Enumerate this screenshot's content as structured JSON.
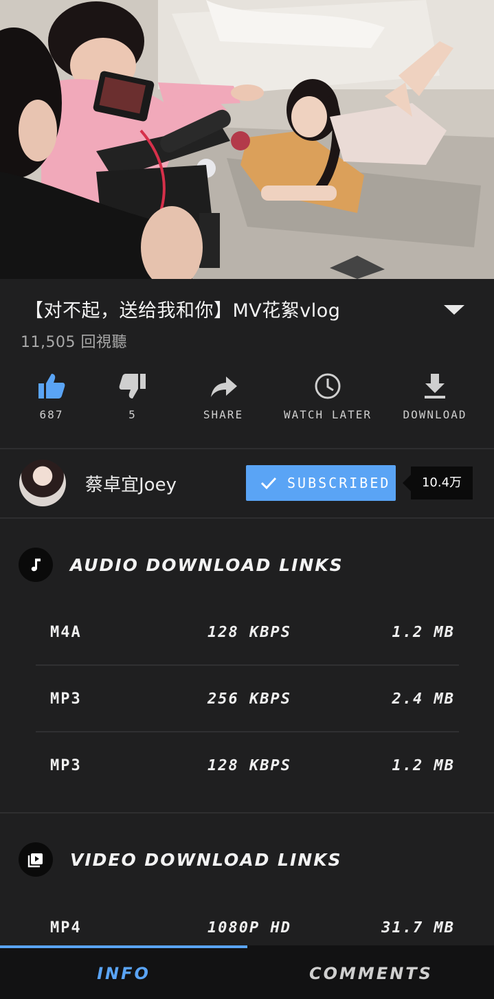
{
  "video": {
    "title": "【对不起，送给我和你】MV花絮vlog",
    "views": "11,505 回視聽"
  },
  "actions": [
    {
      "name": "like",
      "icon": "thumbs-up-icon",
      "label": "687",
      "color": "#5aa4f5"
    },
    {
      "name": "dislike",
      "icon": "thumbs-down-icon",
      "label": "5",
      "color": "#cfcfcf"
    },
    {
      "name": "share",
      "icon": "share-arrow-icon",
      "label": "SHARE",
      "color": "#cfcfcf"
    },
    {
      "name": "watch-later",
      "icon": "clock-icon",
      "label": "WATCH LATER",
      "color": "#cfcfcf"
    },
    {
      "name": "download",
      "icon": "download-icon",
      "label": "DOWNLOAD",
      "color": "#cfcfcf"
    }
  ],
  "channel": {
    "name": "蔡卓宜Joey",
    "subscribe_label": "SUBSCRIBED",
    "subscriber_count": "10.4万"
  },
  "audio_section": {
    "title": "AUDIO DOWNLOAD LINKS",
    "icon": "music-note-icon",
    "rows": [
      {
        "format": "M4A",
        "quality": "128 KBPS",
        "size": "1.2 MB"
      },
      {
        "format": "MP3",
        "quality": "256 KBPS",
        "size": "2.4 MB"
      },
      {
        "format": "MP3",
        "quality": "128 KBPS",
        "size": "1.2 MB"
      }
    ]
  },
  "video_section": {
    "title": "VIDEO DOWNLOAD LINKS",
    "icon": "video-library-icon",
    "rows": [
      {
        "format": "MP4",
        "quality": "1080P HD",
        "size": "31.7 MB"
      }
    ]
  },
  "tabs": {
    "info": "INFO",
    "comments": "COMMENTS",
    "active": "info"
  },
  "colors": {
    "accent": "#5aa4f5",
    "background": "#1f1f20",
    "tab_bar": "#121213"
  }
}
